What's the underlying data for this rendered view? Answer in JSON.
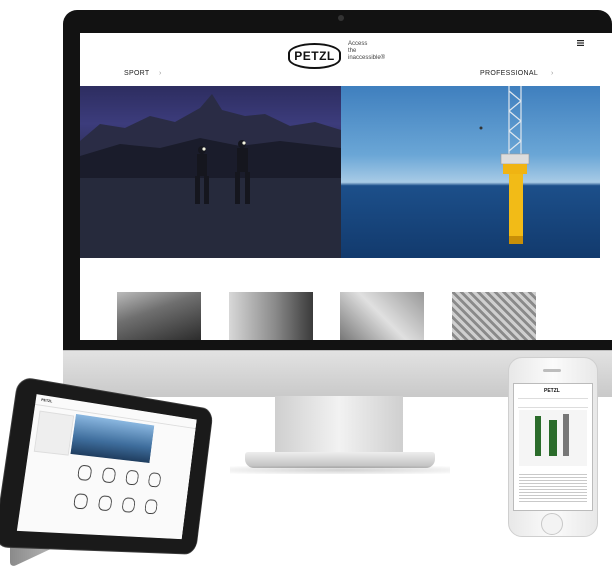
{
  "site": {
    "logo_text": "PETZL",
    "tagline": "Access\nthe\ninaccessible®",
    "menu_icon": "hamburger-icon",
    "nav": {
      "sport_label": "SPORT",
      "professional_label": "PROFESSIONAL",
      "arrow_icon": "chevron-right-icon"
    }
  },
  "hero": {
    "left_caption": "Night hikers with headlamps on a mountain lake",
    "right_caption": "Wind turbine base in the open sea"
  },
  "thumbnails": [
    {
      "name": "thumb-lamp-beam"
    },
    {
      "name": "thumb-person-headlamp"
    },
    {
      "name": "thumb-climbing-hand"
    },
    {
      "name": "thumb-climbing-gear"
    }
  ],
  "devices": {
    "ipad": {
      "logo_text": "PETZL"
    },
    "iphone": {
      "logo_text": "PETZL"
    }
  }
}
